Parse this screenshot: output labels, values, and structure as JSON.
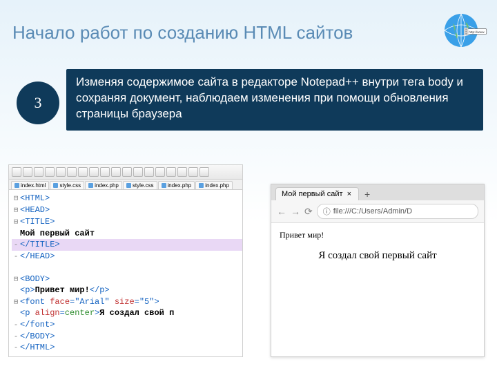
{
  "slide": {
    "title": "Начало работ по созданию HTML сайтов",
    "step_number": "3",
    "step_text": "Изменяя содержимое сайта в редакторе Notepad++ внутри тега body и сохраняя документ, наблюдаем изменения при помощи обновления страницы браузера",
    "globe_tag": "http://www"
  },
  "editor": {
    "tabs": [
      "index.html",
      "style.css",
      "index.php",
      "style.css",
      "index.php",
      "index.php"
    ],
    "lines": [
      {
        "g": "⊟",
        "parts": [
          {
            "c": "tag-blue",
            "t": "<HTML>"
          }
        ]
      },
      {
        "g": "⊟",
        "parts": [
          {
            "c": "tag-blue",
            "t": "<HEAD>"
          }
        ]
      },
      {
        "g": "⊟",
        "parts": [
          {
            "c": "tag-blue",
            "t": "<TITLE>"
          }
        ]
      },
      {
        "g": "",
        "parts": [
          {
            "c": "black",
            "t": "Мой первый сайт"
          }
        ]
      },
      {
        "g": "-",
        "hl": true,
        "parts": [
          {
            "c": "tag-blue",
            "t": "</TITLE>"
          }
        ]
      },
      {
        "g": "-",
        "parts": [
          {
            "c": "tag-blue",
            "t": "</HEAD>"
          }
        ]
      },
      {
        "g": "",
        "parts": []
      },
      {
        "g": "⊟",
        "parts": [
          {
            "c": "tag-blue",
            "t": "<BODY>"
          }
        ]
      },
      {
        "g": "",
        "parts": [
          {
            "c": "tag-blue",
            "t": "<p>"
          },
          {
            "c": "black",
            "t": "Привет мир!"
          },
          {
            "c": "tag-blue",
            "t": "</p>"
          }
        ]
      },
      {
        "g": "⊟",
        "parts": [
          {
            "c": "tag-blue",
            "t": "<font "
          },
          {
            "c": "red",
            "t": "face"
          },
          {
            "c": "tag-blue",
            "t": "=\"Arial\" "
          },
          {
            "c": "red",
            "t": "size"
          },
          {
            "c": "tag-blue",
            "t": "=\"5\">"
          }
        ]
      },
      {
        "g": "",
        "parts": [
          {
            "c": "tag-blue",
            "t": "<p "
          },
          {
            "c": "red",
            "t": "align"
          },
          {
            "c": "tag-blue",
            "t": "="
          },
          {
            "c": "green",
            "t": "center"
          },
          {
            "c": "tag-blue",
            "t": ">"
          },
          {
            "c": "black",
            "t": "Я создал свой п"
          }
        ]
      },
      {
        "g": "-",
        "parts": [
          {
            "c": "tag-blue",
            "t": "</font>"
          }
        ]
      },
      {
        "g": "-",
        "parts": [
          {
            "c": "tag-blue",
            "t": "</BODY>"
          }
        ]
      },
      {
        "g": "-",
        "parts": [
          {
            "c": "tag-blue",
            "t": "</HTML>"
          }
        ]
      }
    ]
  },
  "browser": {
    "tab_title": "Мой первый сайт",
    "tab_close": "×",
    "plus": "+",
    "back": "←",
    "fwd": "→",
    "reload": "⟳",
    "info": "ⓘ",
    "url": "file:///C:/Users/Admin/D",
    "p1": "Привет мир!",
    "p2": "Я создал свой первый сайт"
  }
}
